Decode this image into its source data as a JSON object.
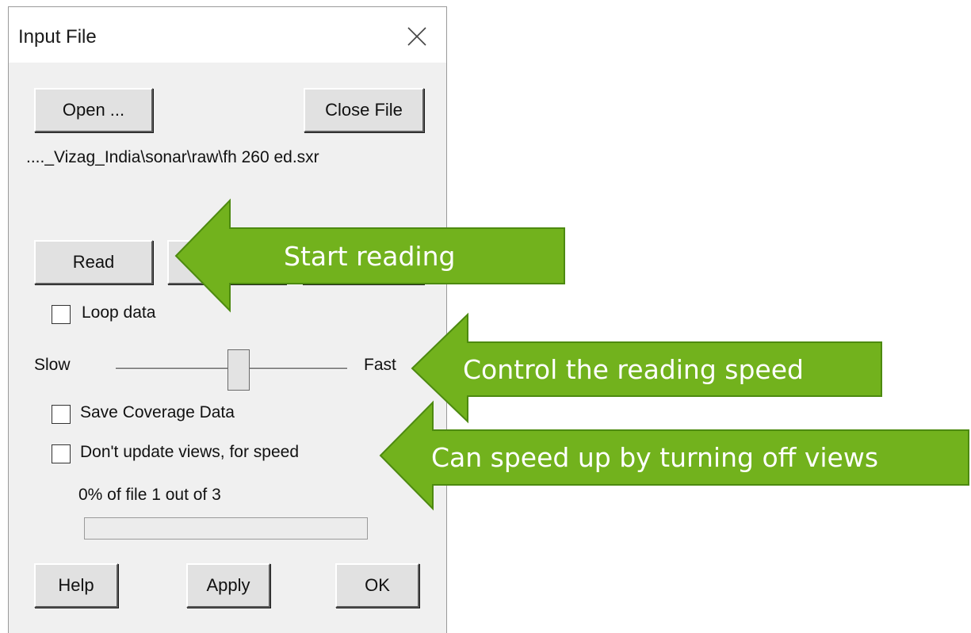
{
  "dialog": {
    "title": "Input File",
    "open_button": "Open ...",
    "close_file_button": "Close File",
    "file_path": "...._Vizag_India\\sonar\\raw\\fh 260 ed.sxr",
    "read_button": "Read",
    "loop_data_label": "Loop data",
    "loop_data_checked": false,
    "slider": {
      "min_label": "Slow",
      "max_label": "Fast",
      "value": 0.53
    },
    "save_coverage_label": "Save Coverage Data",
    "save_coverage_checked": false,
    "dont_update_label": "Don't update views, for speed",
    "dont_update_checked": false,
    "progress_text": "0% of file 1 out of 3",
    "progress_value": 0,
    "help_button": "Help",
    "apply_button": "Apply",
    "ok_button": "OK"
  },
  "callouts": {
    "start_reading": "Start reading",
    "control_speed": "Control the reading speed",
    "speed_up": "Can speed up by turning off views"
  },
  "colors": {
    "arrow_fill": "#72b21d",
    "arrow_outline": "#4d8a10",
    "dialog_bg": "#f0f0f0",
    "progress_fill": "#06b025"
  }
}
